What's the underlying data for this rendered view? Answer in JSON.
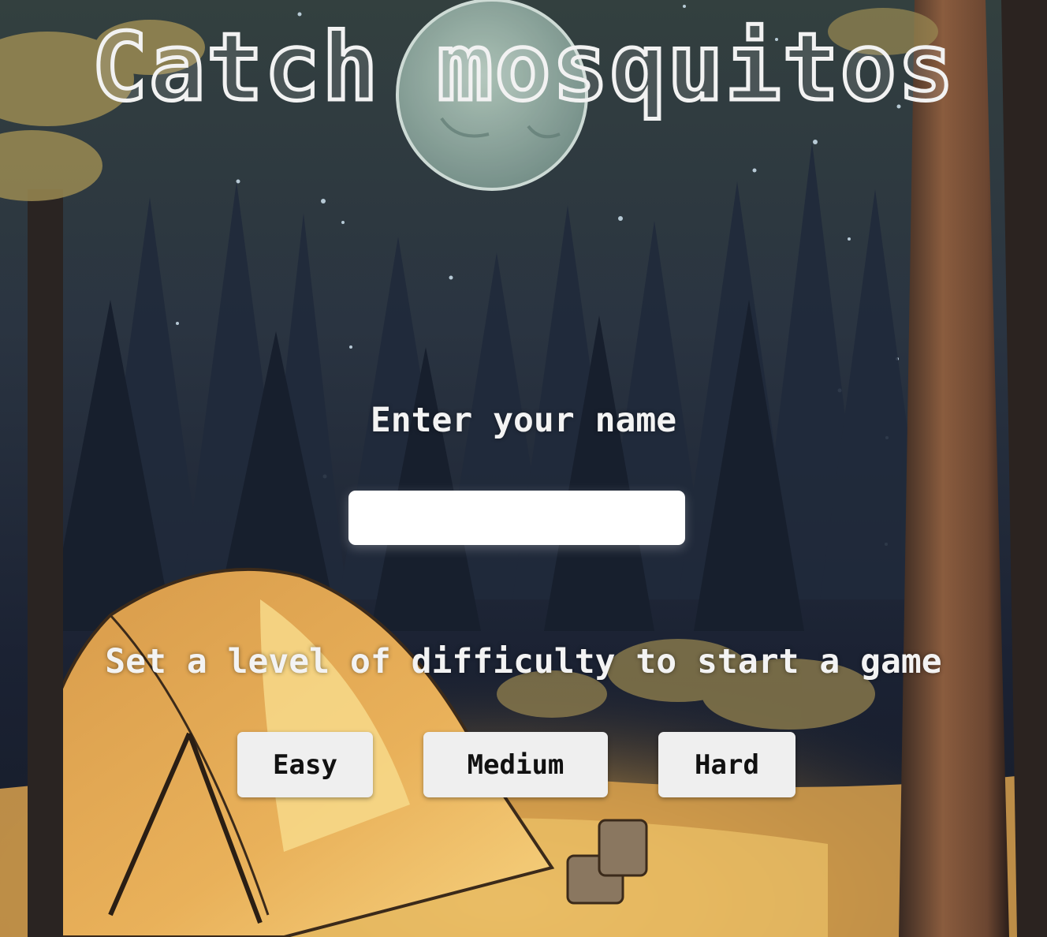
{
  "game": {
    "title": "Catch mosquitos"
  },
  "name_form": {
    "label": "Enter your name",
    "input_value": "",
    "input_placeholder": ""
  },
  "difficulty": {
    "label": "Set a level of difficulty to start a game",
    "options": [
      {
        "label": "Easy"
      },
      {
        "label": "Medium"
      },
      {
        "label": "Hard"
      }
    ]
  },
  "colors": {
    "sky": "#2e3a45",
    "forest": "#1a2232",
    "campfire_glow": "#f2c461",
    "tent": "#d8913a",
    "button_bg": "#efefef",
    "text": "#f3f3f3"
  }
}
